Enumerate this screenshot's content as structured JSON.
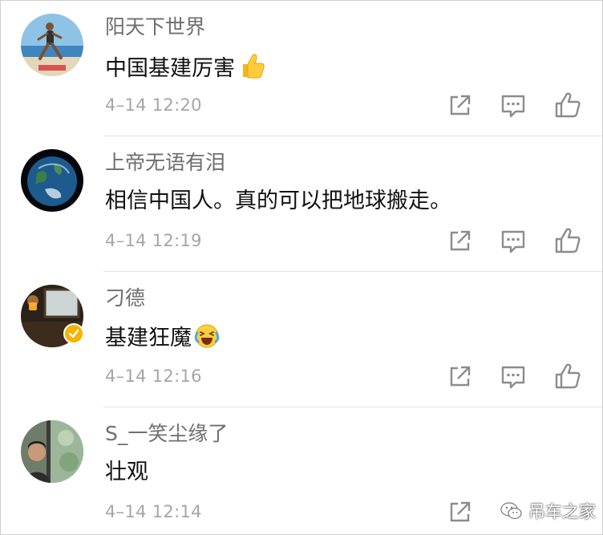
{
  "comments": [
    {
      "username": "阳天下世界",
      "text": "中国基建厉害",
      "emoji": "thumbs-up",
      "time": "4–14 12:20"
    },
    {
      "username": "上帝无语有泪",
      "text": "相信中国人。真的可以把地球搬走。",
      "emoji": "",
      "time": "4–14 12:19"
    },
    {
      "username": "刁德",
      "text": "基建狂魔",
      "emoji": "laughing-crying",
      "time": "4–14 12:16",
      "verified": true
    },
    {
      "username": "S_一笑尘缘了",
      "text": "壮观",
      "emoji": "",
      "time": "4–14 12:14"
    }
  ],
  "watermark": {
    "label": "吊车之家"
  },
  "icons": {
    "share": "share-icon",
    "reply": "comment-icon",
    "like": "thumbs-up-icon"
  },
  "colors": {
    "username": "#6e6e6e",
    "text": "#111111",
    "time": "#a6a6a6",
    "icon": "#8c8c8c",
    "divider": "#e3e3e3",
    "badge": "#f5b400"
  }
}
